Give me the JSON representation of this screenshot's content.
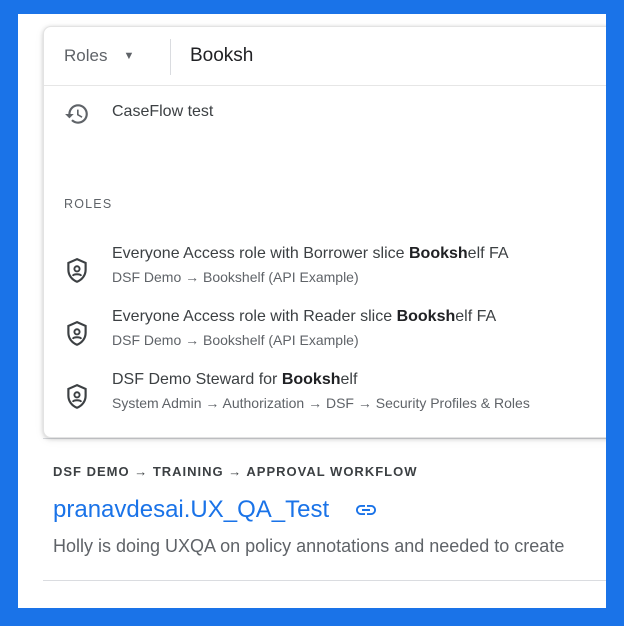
{
  "search": {
    "scope_label": "Roles",
    "query": "Booksh"
  },
  "recent": {
    "label": "CaseFlow test",
    "icon": "history-icon"
  },
  "roles_section": {
    "heading": "ROLES",
    "icon": "shield-person-icon",
    "items": [
      {
        "title_pre": "Everyone Access role with Borrower slice ",
        "title_match": "Booksh",
        "title_post": "elf FA",
        "path": "DSF Demo → Bookshelf (API Example)"
      },
      {
        "title_pre": "Everyone Access role with Reader slice ",
        "title_match": "Booksh",
        "title_post": "elf FA",
        "path": "DSF Demo → Bookshelf (API Example)"
      },
      {
        "title_pre": "DSF Demo Steward for ",
        "title_match": "Booksh",
        "title_post": "elf",
        "path": "System Admin → Authorization → DSF → Security Profiles & Roles"
      }
    ]
  },
  "background_result": {
    "breadcrumb": "DSF DEMO → TRAINING → APPROVAL WORKFLOW",
    "title": "pranavdesai.UX_QA_Test",
    "link_icon": "link-icon",
    "description": "Holly is doing UXQA on policy annotations and needed to create"
  },
  "colors": {
    "accent": "#1a73e8",
    "frame_border": "#1a73e8"
  }
}
